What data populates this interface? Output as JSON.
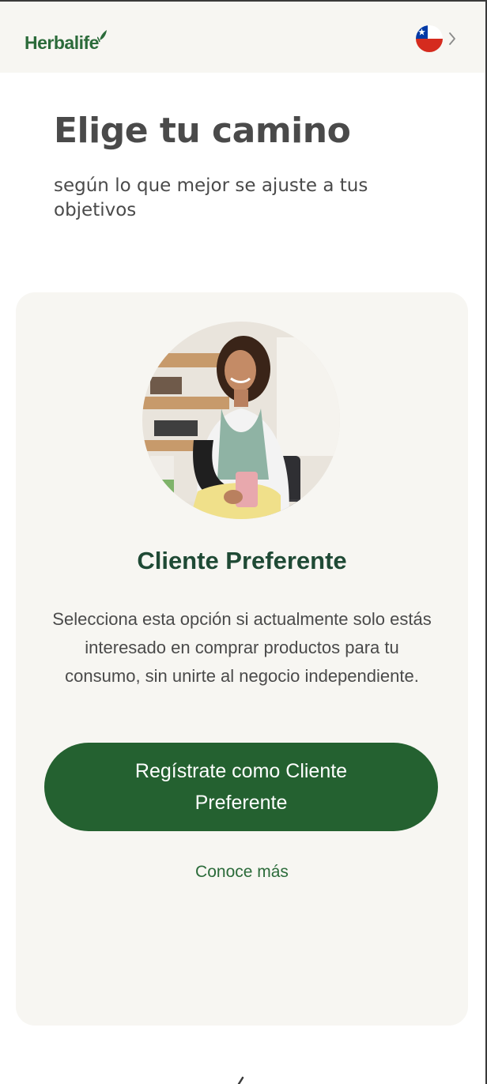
{
  "header": {
    "logo_text": "Herbalife",
    "country_flag": "chile-flag-icon",
    "country_chevron": "chevron-right-icon"
  },
  "main": {
    "title": "Elige tu camino",
    "subtitle": "según lo que mejor se ajuste a tus objetivos"
  },
  "card": {
    "image_alt": "woman-with-shake-photo",
    "title": "Cliente Preferente",
    "description": "Selecciona esta opción si actualmente solo estás interesado en comprar productos para tu consumo, sin unirte al negocio independiente.",
    "cta_label": "Regístrate como Cliente Preferente",
    "more_link": "Conoce más"
  },
  "colors": {
    "brand_green": "#246130",
    "logo_green": "#2b6b3a",
    "title_green": "#1f4a35",
    "card_bg": "#f7f6f2",
    "text_gray": "#4a4a4a"
  }
}
